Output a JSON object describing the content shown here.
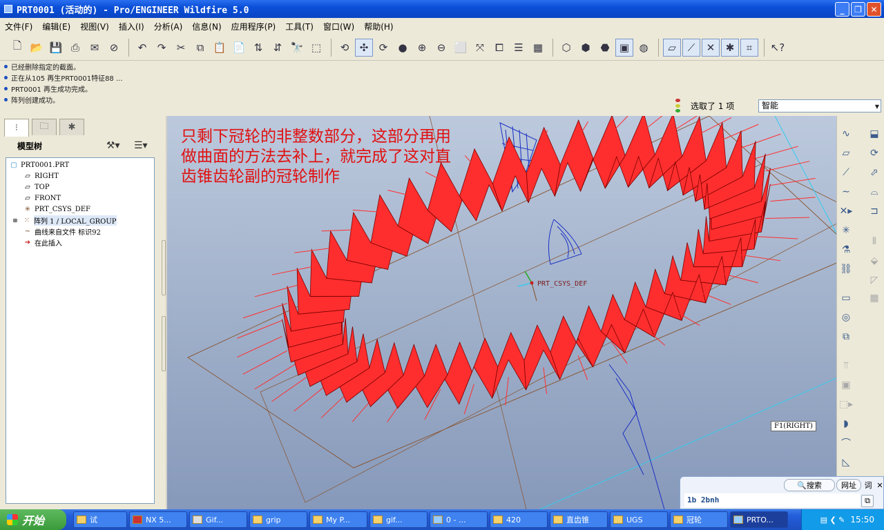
{
  "window": {
    "title": "PRT0001 (活动的) - Pro/ENGINEER Wildfire 5.0"
  },
  "menu": [
    "文件(F)",
    "编辑(E)",
    "视图(V)",
    "插入(I)",
    "分析(A)",
    "信息(N)",
    "应用程序(P)",
    "工具(T)",
    "窗口(W)",
    "帮助(H)"
  ],
  "messages": [
    "已经删除指定的截面。",
    "正在从105 再生PRT0001特征88 ...",
    "PRT0001 再生成功完成。",
    "阵列创建成功。"
  ],
  "selection": {
    "status": "选取了 1 项",
    "filter": "智能"
  },
  "model_tree": {
    "title": "模型树",
    "items": [
      {
        "label": "PRT0001.PRT",
        "icon": "part-icon"
      },
      {
        "label": "RIGHT",
        "icon": "datum-plane-icon"
      },
      {
        "label": "TOP",
        "icon": "datum-plane-icon"
      },
      {
        "label": "FRONT",
        "icon": "datum-plane-icon"
      },
      {
        "label": "PRT_CSYS_DEF",
        "icon": "csys-icon"
      },
      {
        "label": "阵列 1 / LOCAL_GROUP",
        "icon": "pattern-icon"
      },
      {
        "label": "曲线来自文件 标识92",
        "icon": "curve-icon"
      },
      {
        "label": "在此插入",
        "icon": "insert-arrow-icon"
      }
    ]
  },
  "graphics": {
    "annotation": "只剩下冠轮的非整数部分，这部分再用做曲面的方法去补上，就完成了这对直齿锥齿轮副的冠轮制作",
    "csys_label": "PRT_CSYS_DEF",
    "datum_label": "F1(RIGHT)",
    "colors": {
      "gear": "#ff2e2e",
      "curve": "#1a2fc4",
      "frame": "#8a5a3a",
      "axis": "#33ccee"
    }
  },
  "search_bar": {
    "search": "搜索",
    "url": "网址",
    "word": "词",
    "input": "1b 2bnh"
  },
  "taskbar": {
    "start": "开始",
    "tasks": [
      "试",
      "NX 5...",
      "Gif...",
      "grip",
      "My P...",
      "gif...",
      "0 - ...",
      "420",
      "直齿锥",
      "UGS",
      "冠轮",
      "PRTO..."
    ],
    "clock": "15:50"
  }
}
